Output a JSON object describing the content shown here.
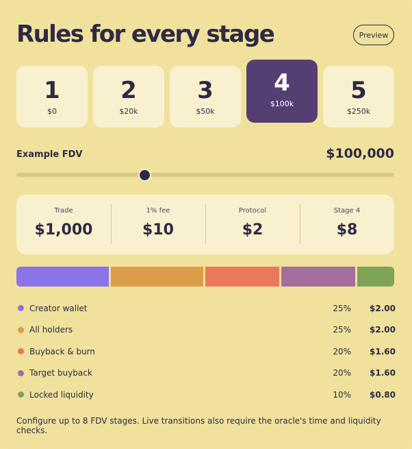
{
  "header": {
    "title": "Rules for every stage",
    "preview_label": "Preview"
  },
  "stages": [
    {
      "number": "1",
      "value": "$0"
    },
    {
      "number": "2",
      "value": "$20k"
    },
    {
      "number": "3",
      "value": "$50k"
    },
    {
      "number": "4",
      "value": "$100k",
      "selected": true
    },
    {
      "number": "5",
      "value": "$250k"
    }
  ],
  "fdv": {
    "label": "Example FDV",
    "value": "$100,000",
    "slider_level": 0.34
  },
  "stats": [
    {
      "label": "Trade",
      "value": "$1,000"
    },
    {
      "label": "1% fee",
      "value": "$10"
    },
    {
      "label": "Protocol",
      "value": "$2"
    },
    {
      "label": "Stage 4",
      "value": "$8"
    }
  ],
  "allocations": [
    {
      "name": "Creator wallet",
      "percent": "25%",
      "amount": "$2.00",
      "color": "#8b74ea"
    },
    {
      "name": "All holders",
      "percent": "25%",
      "amount": "$2.00",
      "color": "#db9d48"
    },
    {
      "name": "Buyback & burn",
      "percent": "20%",
      "amount": "$1.60",
      "color": "#e9795a"
    },
    {
      "name": "Target buyback",
      "percent": "20%",
      "amount": "$1.60",
      "color": "#a46e9e"
    },
    {
      "name": "Locked liquidity",
      "percent": "10%",
      "amount": "$0.80",
      "color": "#7ea457"
    }
  ],
  "footer": "Configure up to 8 FDV stages. Live transitions also require the oracle's time and liquidity checks."
}
